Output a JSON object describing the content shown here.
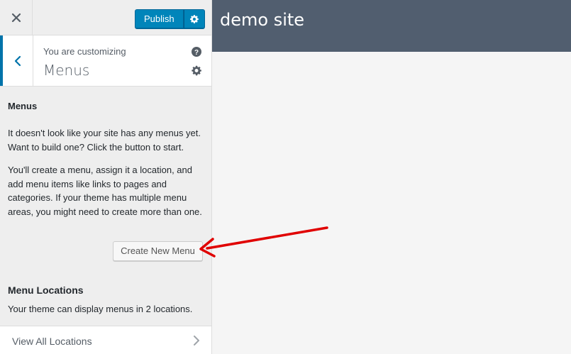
{
  "topbar": {
    "publish_label": "Publish"
  },
  "section_header": {
    "customizing_label": "You are customizing",
    "title": "Menus"
  },
  "panel": {
    "heading": "Menus",
    "paragraph1": "It doesn't look like your site has any menus yet. Want to build one? Click the button to start.",
    "paragraph2": "You'll create a menu, assign it a location, and add menu items like links to pages and categories. If your theme has multiple menu areas, you might need to create more than one.",
    "create_button_label": "Create New Menu",
    "locations_heading": "Menu Locations",
    "locations_desc": "Your theme can display menus in 2 locations.",
    "view_all_label": "View All Locations"
  },
  "preview": {
    "site_title": "demo site"
  },
  "colors": {
    "accent": "#0085ba",
    "header_bg": "#515e6f",
    "arrow": "#e00000"
  },
  "icons": [
    "close-icon",
    "gear-icon",
    "back-arrow-icon",
    "help-icon",
    "chevron-right-icon"
  ]
}
